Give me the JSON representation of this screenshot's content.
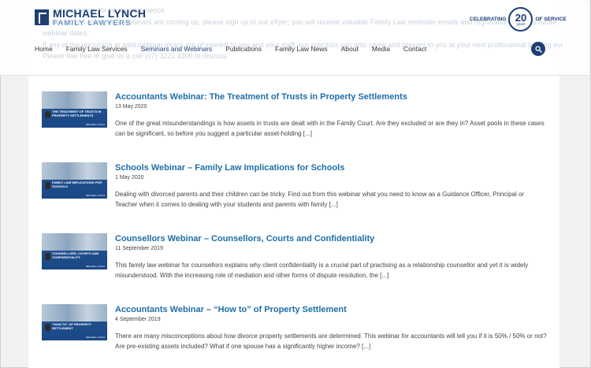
{
  "header": {
    "ghost_lines": [
      "...                   ...ebinar below for your convenience.",
      "To be notified about what webinars are coming up, please sign up to our eflyer; you will receive valuable Family Law reminder emails and registration dates to future",
      "webinar dates.",
      "If any of the upcoming or past webinar topics are of interest to you and your staff, our solicitors can also come and present to you at your next professional training event.",
      "Please feel free to give us a call (07) 3221 4300 to discuss."
    ],
    "logo": {
      "name": "MICHAEL LYNCH",
      "sub": "FAMILY LAWYERS"
    },
    "badge": {
      "left": "CELEBRATING",
      "number": "20",
      "years": "years",
      "right": "OF SERVICE"
    },
    "nav": {
      "items": [
        {
          "label": "Home",
          "active": false
        },
        {
          "label": "Family Law Services",
          "active": false
        },
        {
          "label": "Seminars and Webinars",
          "active": true
        },
        {
          "label": "Publications",
          "active": false
        },
        {
          "label": "Family Law News",
          "active": false
        },
        {
          "label": "About",
          "active": false
        },
        {
          "label": "Media",
          "active": false
        },
        {
          "label": "Contact",
          "active": false
        }
      ]
    },
    "search_icon": "search-icon",
    "colors": {
      "brand": "#1d3f73",
      "link": "#1d6fa8"
    }
  },
  "posts": [
    {
      "title": "Accountants Webinar: The Treatment of Trusts in Property Settlements",
      "date": "13 May 2020",
      "excerpt": "One of the great misunderstandings is how assets in trusts are dealt with in the Family Court. Are they excluded or are they in? Asset pools in these cases can be significant, so before you suggest a particular asset-holding [...]",
      "thumb_title": "THE TREATMENT OF TRUSTS IN PROPERTY SETTLEMENTS",
      "thumb_brand": "MICHAEL LYNCH"
    },
    {
      "title": "Schools Webinar – Family Law Implications for Schools",
      "date": "1 May 2020",
      "excerpt": "Dealing with divorced parents and their children can be tricky. Find out from this webinar what you need to know as a Guidance Officer, Principal or Teacher when it comes to dealing with your students and parents with family [...]",
      "thumb_title": "FAMILY LAW IMPLICATIONS FOR SCHOOLS",
      "thumb_brand": "MICHAEL LYNCH"
    },
    {
      "title": "Counsellors Webinar – Counsellors, Courts and Confidentiality",
      "date": "11 September 2019",
      "excerpt": "This family law webinar for counsellors explains why client confidentiality is a crucial part of practising as a relationship counsellor and yet it is widely misunderstood. With the increasing role of mediation and other forms of dispute resolution, the [...]",
      "thumb_title": "COUNSELLORS, COURTS AND CONFIDENTIALITY",
      "thumb_brand": "MICHAEL LYNCH"
    },
    {
      "title": "Accountants Webinar – “How to” of Property Settlement",
      "date": "4 September 2019",
      "excerpt": "There are many misconceptions about how divorce property settlements are determined. This webinar for accountants will tell you if it is 50% / 50% or not? Are pre-existing assets included? What if one spouse has a significantly higher income? [...]",
      "thumb_title": "\"HOW TO\" OF PROPERTY SETTLEMENT",
      "thumb_brand": "MICHAEL LYNCH"
    }
  ]
}
